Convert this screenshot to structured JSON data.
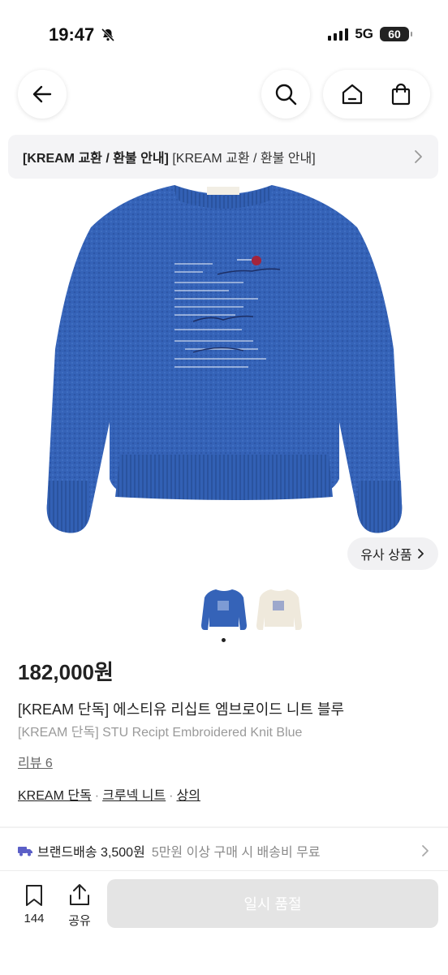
{
  "status_bar": {
    "time": "19:47",
    "network": "5G",
    "battery": "60"
  },
  "top_nav": {
    "back_icon": "arrow-left-icon",
    "search_icon": "search-icon",
    "home_icon": "home-icon",
    "cart_icon": "shopping-bag-icon"
  },
  "notice": {
    "bold_text": "[KREAM 교환 / 환불 안내]",
    "text": "[KREAM 교환 / 환불 안내]"
  },
  "similar_button": "유사 상품",
  "product": {
    "price": "182,000원",
    "name_ko": "[KREAM 단독] 에스티유 리십트 엠브로이드 니트 블루",
    "name_en": "[KREAM 단독] STU Recipt Embroidered Knit Blue",
    "reviews": "리뷰 6",
    "tags": [
      "KREAM 단독",
      "크루넥 니트",
      "상의"
    ],
    "colors": {
      "blue": "#3563b8",
      "cream": "#efe9dc"
    }
  },
  "shipping": {
    "label": "브랜드배송 3,500원",
    "sub": "5만원 이상 구매 시 배송비 무료"
  },
  "bottom_bar": {
    "bookmark_count": "144",
    "share_label": "공유",
    "soldout_label": "일시 품절"
  }
}
